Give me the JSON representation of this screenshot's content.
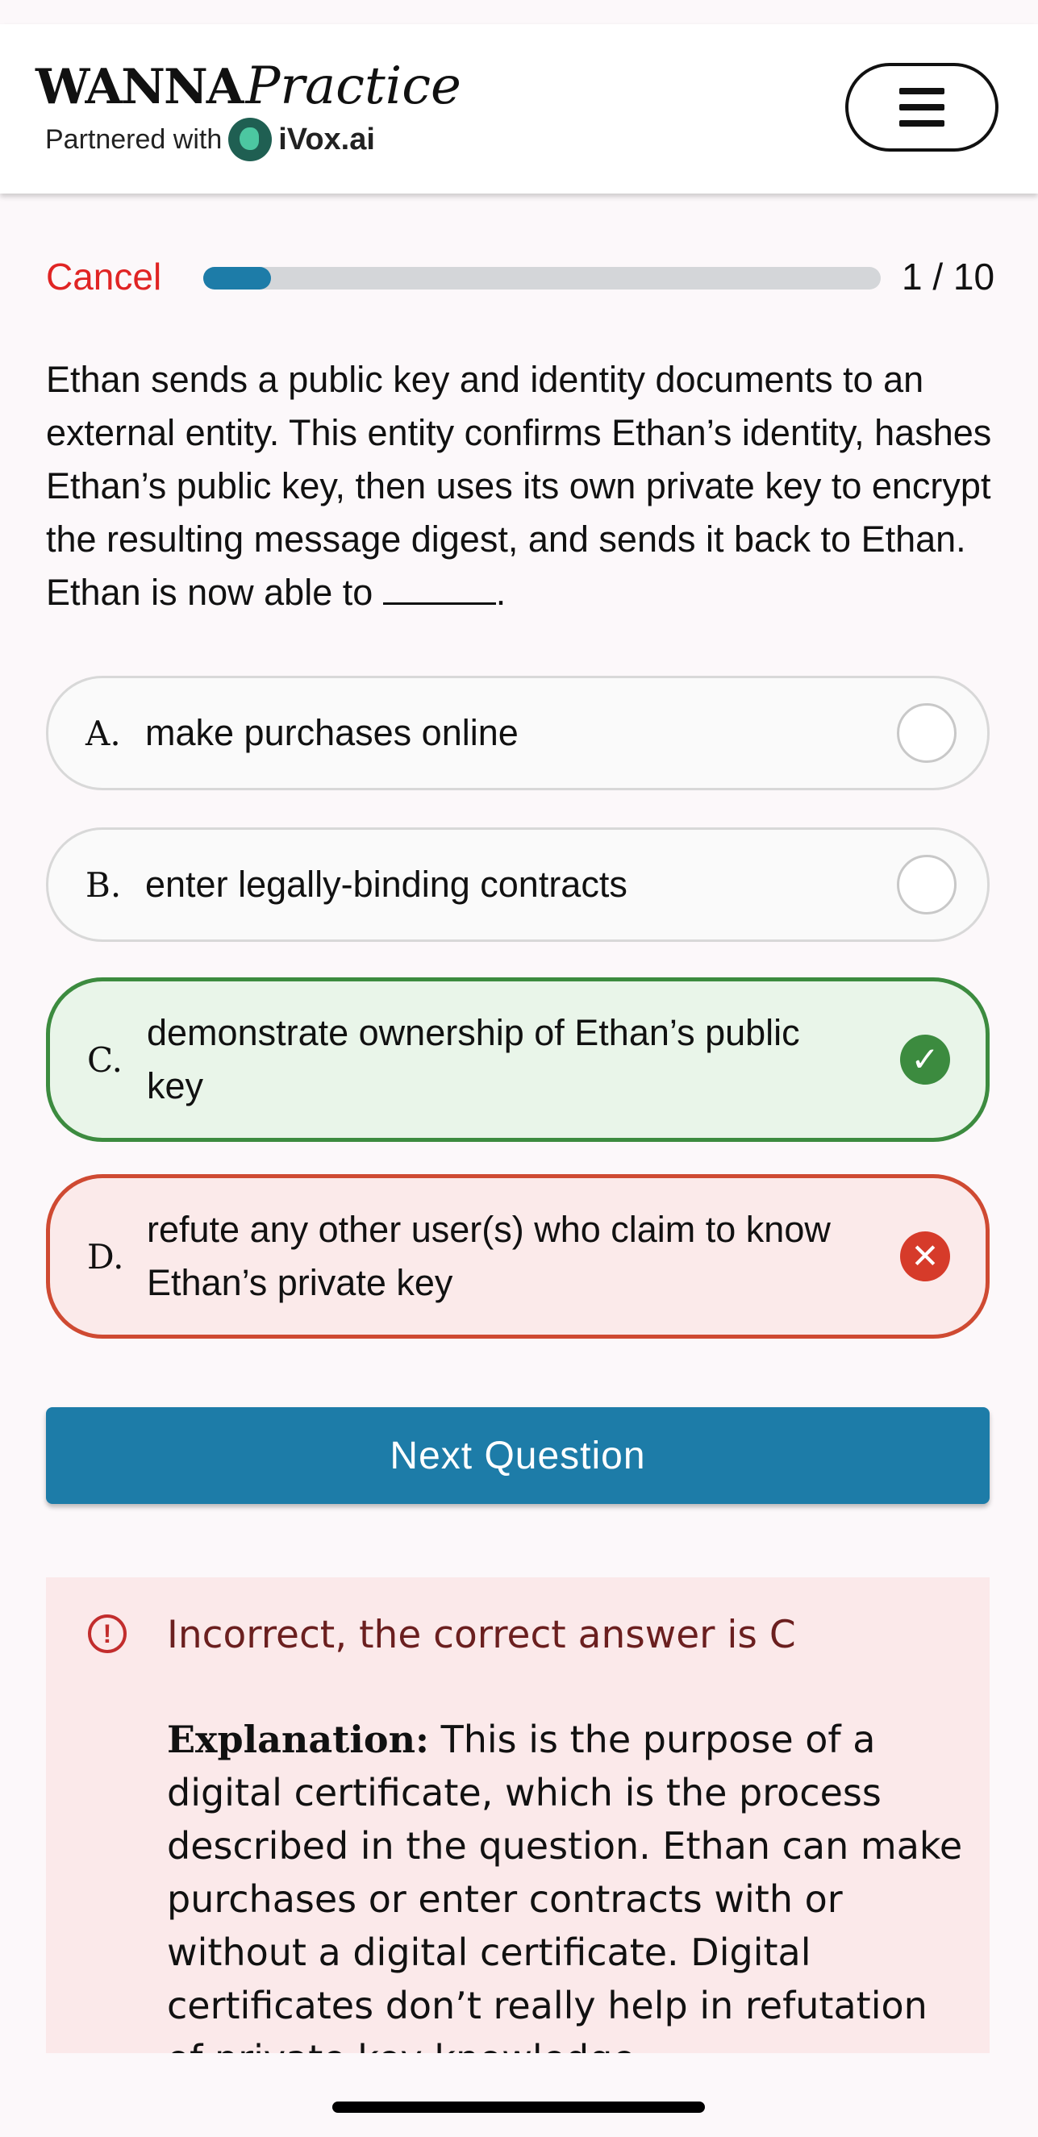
{
  "header": {
    "brand_word": "WANNA",
    "brand_script": "Practice",
    "partnered_label": "Partnered with",
    "partner_name": "iVox.ai"
  },
  "quiz": {
    "cancel_label": "Cancel",
    "progress_text": "1 / 10",
    "progress_fraction": 0.1,
    "question_before_blank": "Ethan sends a public key and identity documents to an external entity. This entity confirms Ethan’s identity, hashes Ethan’s public key, then uses its own private key to encrypt the resulting message digest, and sends it back to Ethan. Ethan is now able to ",
    "question_after_blank": ".",
    "options": [
      {
        "letter": "A.",
        "text": "make purchases online",
        "state": "unselected"
      },
      {
        "letter": "B.",
        "text": "enter legally-binding contracts",
        "state": "unselected"
      },
      {
        "letter": "C.",
        "text": "demonstrate ownership of Ethan’s public key",
        "state": "correct"
      },
      {
        "letter": "D.",
        "text": "refute any other user(s) who claim to know Ethan’s private key",
        "state": "incorrect"
      }
    ],
    "next_label": "Next Question"
  },
  "feedback": {
    "title": "Incorrect, the correct answer is C",
    "explanation_label": "Explanation:",
    "explanation_text": " This is the purpose of a digital certificate, which is the process described in the question. Ethan can make purchases or enter contracts with or without a digital certificate. Digital certificates don’t really help in refutation of private key knowledge."
  },
  "colors": {
    "accent": "#1d7ca8",
    "cancel": "#e02424",
    "correct": "#3c8b3f",
    "incorrect": "#cf4a32",
    "feedback_bg": "#fbe9ea"
  },
  "icons": {
    "menu": "hamburger-menu-icon",
    "correct": "check-circle-icon",
    "incorrect": "x-circle-icon",
    "alert": "exclamation-circle-icon"
  }
}
